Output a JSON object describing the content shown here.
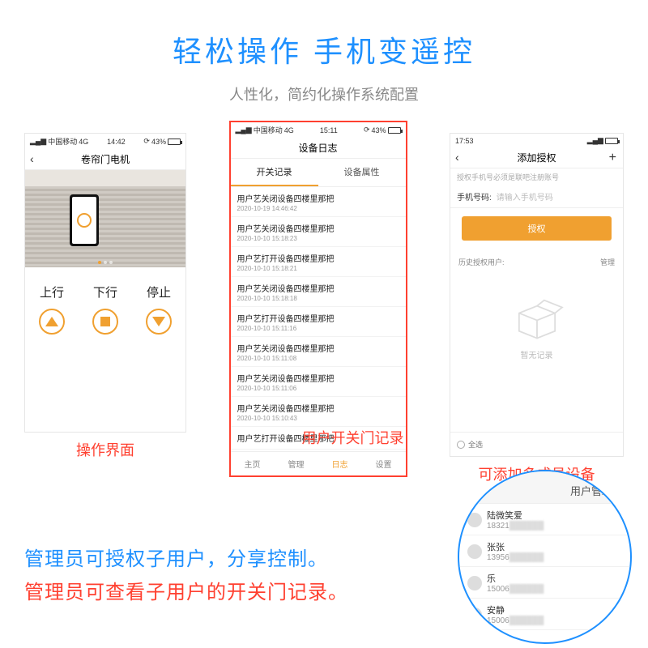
{
  "heading": "轻松操作  手机变遥控",
  "subheading": "人性化，简约化操作系统配置",
  "status": {
    "carrier": "中国移动",
    "network": "4G",
    "time1": "14:42",
    "time2": "15:11",
    "time3": "17:53",
    "battery": "43%"
  },
  "phone1": {
    "title": "卷帘门电机",
    "up": "上行",
    "down": "下行",
    "stop": "停止",
    "caption": "操作界面"
  },
  "phone2": {
    "title": "设备日志",
    "tab_records": "开关记录",
    "tab_props": "设备属性",
    "logs": [
      {
        "t": "用户艺关闭设备四楼里那把",
        "d": "2020-10-19 14:46:42"
      },
      {
        "t": "用户艺关闭设备四楼里那把",
        "d": "2020-10-10 15:18:23"
      },
      {
        "t": "用户艺打开设备四楼里那把",
        "d": "2020-10-10 15:18:21"
      },
      {
        "t": "用户艺关闭设备四楼里那把",
        "d": "2020-10-10 15:18:18"
      },
      {
        "t": "用户艺打开设备四楼里那把",
        "d": "2020-10-10 15:11:16"
      },
      {
        "t": "用户艺关闭设备四楼里那把",
        "d": "2020-10-10 15:11:08"
      },
      {
        "t": "用户艺关闭设备四楼里那把",
        "d": "2020-10-10 15:11:06"
      },
      {
        "t": "用户艺关闭设备四楼里那把",
        "d": "2020-10-10 15:10:43"
      },
      {
        "t": "用户艺打开设备四楼里那把",
        "d": ""
      }
    ],
    "btabs": {
      "home": "主页",
      "manage": "管理",
      "log": "日志",
      "settings": "设置"
    },
    "overlay": "用户开关门记录"
  },
  "phone3": {
    "title": "添加授权",
    "note": "授权手机号必须是联吧注册账号",
    "field_label": "手机号码:",
    "field_ph": "请输入手机号码",
    "btn": "授权",
    "hist_left": "历史授权用户:",
    "hist_right": "管理",
    "empty": "暂无记录",
    "select_all": "全选",
    "caption": "可添加多成员设备"
  },
  "popover": {
    "header": "用户管理",
    "users": [
      {
        "name": "陆微笑爱",
        "phone": "18321"
      },
      {
        "name": "张张",
        "phone": "13956"
      },
      {
        "name": "乐",
        "phone": "15006"
      },
      {
        "name": "安静",
        "phone": "15006"
      }
    ]
  },
  "sentences": {
    "line1": "管理员可授权子用户，分享控制。",
    "line2": "管理员可查看子用户的开关门记录。"
  }
}
